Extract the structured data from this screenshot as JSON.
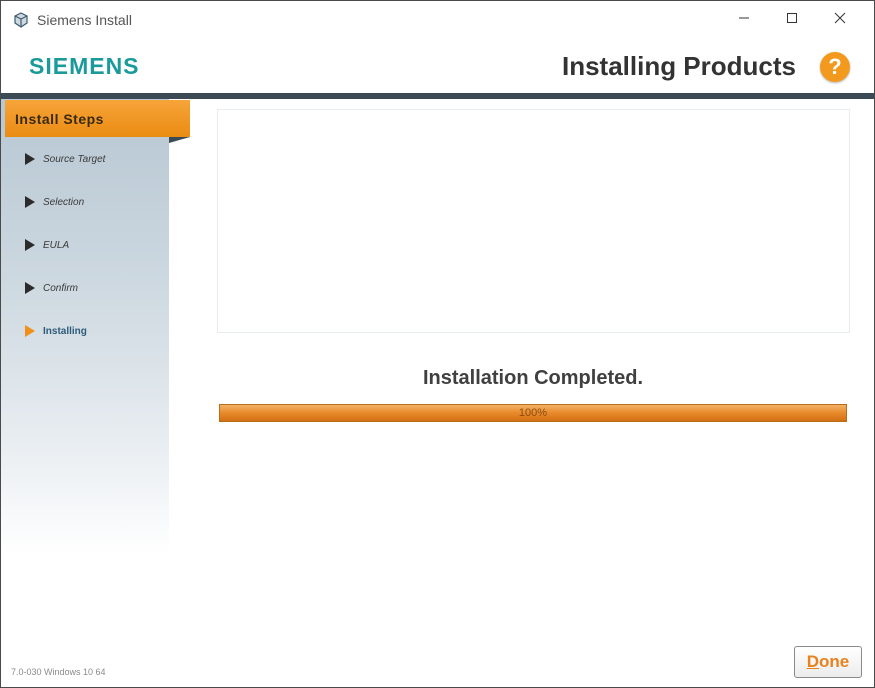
{
  "window": {
    "title": "Siemens Install",
    "icon": "installer-app-icon",
    "controls": {
      "minimize": "minimize-icon",
      "maximize": "maximize-icon",
      "close": "close-icon"
    }
  },
  "header": {
    "logo": "SIEMENS",
    "title": "Installing Products",
    "help_icon": "?"
  },
  "sidebar": {
    "heading": "Install Steps",
    "steps": [
      {
        "label": "Source Target",
        "active": false
      },
      {
        "label": "Selection",
        "active": false
      },
      {
        "label": "EULA",
        "active": false
      },
      {
        "label": "Confirm",
        "active": false
      },
      {
        "label": "Installing",
        "active": true
      }
    ]
  },
  "main": {
    "status": "Installation Completed.",
    "progress": {
      "value": 1.0,
      "label": "100%"
    }
  },
  "footer": {
    "version": "7.0-030  Windows 10 64",
    "done_first": "D",
    "done_rest": "one"
  },
  "colors": {
    "accent": "#f39a1e",
    "brand": "#1a9a9a",
    "header_bar": "#3c4a55"
  }
}
